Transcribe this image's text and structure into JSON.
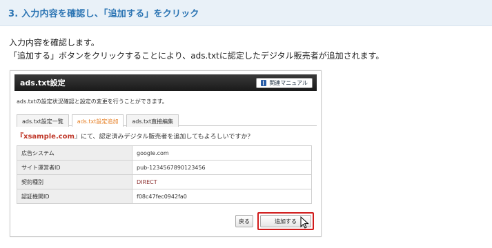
{
  "header": {
    "title": "3. 入力内容を確認し、「追加する」をクリック"
  },
  "intro": {
    "line1": "入力内容を確認します。",
    "line2": "「追加する」ボタンをクリックすることにより、ads.txtに認定したデジタル販売者が追加されます。"
  },
  "panel": {
    "title": "ads.txt設定",
    "manual_label": "関連マニュアル",
    "description": "ads.txtの設定状況確認と設定の変更を行うことができます。",
    "tabs": [
      {
        "label": "ads.txt設定一覧"
      },
      {
        "label": "ads.txt設定追加"
      },
      {
        "label": "ads.txt直接編集"
      }
    ],
    "confirm_prefix": "『",
    "confirm_site": "xsample.com",
    "confirm_suffix": "』にて、認定済みデジタル販売者を追加してもよろしいですか？",
    "rows": [
      {
        "label": "広告システム",
        "value": "google.com"
      },
      {
        "label": "サイト運営者ID",
        "value": "pub-1234567890123456"
      },
      {
        "label": "契約種別",
        "value": "DIRECT"
      },
      {
        "label": "認証機関ID",
        "value": "f08c47fec0942fa0"
      }
    ],
    "back_label": "戻る",
    "add_label": "追加する"
  },
  "colors": {
    "accent_blue": "#2b74b3",
    "active_tab": "#e67e22",
    "highlight": "#d11b1b"
  }
}
